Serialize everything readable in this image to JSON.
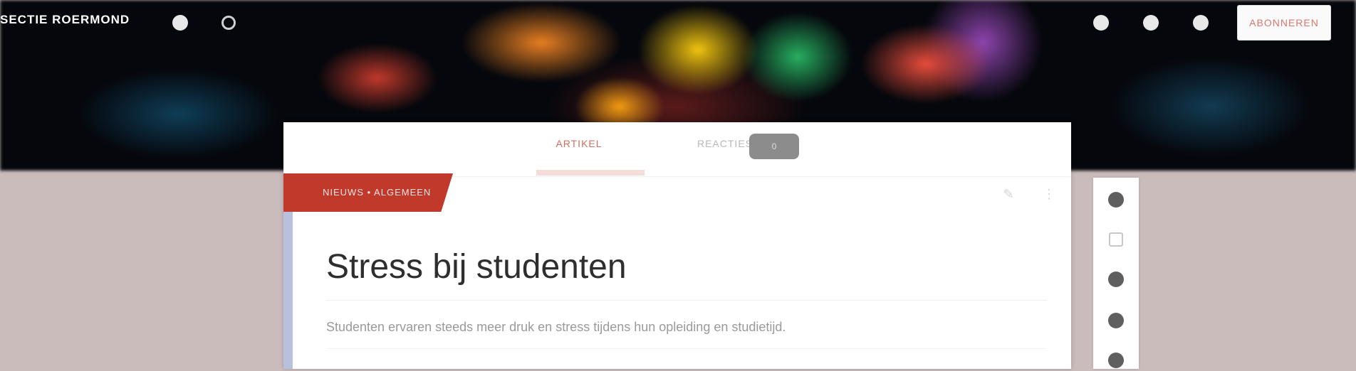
{
  "header": {
    "brand": "SECTIE ROERMOND",
    "subscribe_label": "ABONNEREN",
    "icons": [
      "comment-icon",
      "search-icon",
      "circle-icon",
      "share-icon",
      "account-icon",
      "menu-icon"
    ]
  },
  "tabs": [
    {
      "label": "ARTIKEL",
      "active": true
    },
    {
      "label": "REACTIES",
      "active": false,
      "badge": "0"
    }
  ],
  "article": {
    "ribbon_label": "NIEUWS • ALGEMEEN",
    "title": "Stress bij studenten",
    "subtitle": "Studenten ervaren steeds meer druk en stress tijdens hun opleiding en studietijd.",
    "actions": [
      "edit-icon",
      "more-icon"
    ]
  },
  "side_toolbar": {
    "items": [
      "play-icon",
      "text-size-icon",
      "share-icon",
      "bookmark-icon",
      "print-icon"
    ]
  },
  "colors": {
    "accent": "#c0392b",
    "page_background": "#cbbcbc",
    "tab_active": "#d36c60"
  }
}
